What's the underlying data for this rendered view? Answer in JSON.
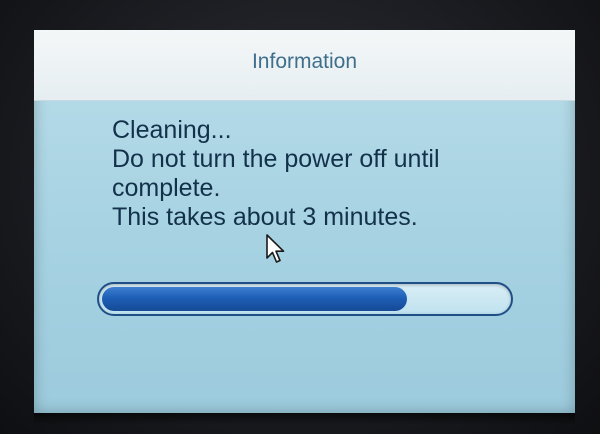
{
  "dialog": {
    "title": "Information",
    "message_lines": [
      "Cleaning...",
      "Do not turn the power off until",
      "complete.",
      "This takes about 3 minutes."
    ]
  },
  "progress": {
    "fraction": 0.75
  },
  "cursor": {
    "icon": "arrow-pointer-icon"
  },
  "colors": {
    "screen_bg": "#a6d2e2",
    "titlebar_bg": "#eef4f6",
    "title_text": "#3f6f8c",
    "message_text": "#13314a",
    "progress_fill": "#1e5eb6",
    "progress_border": "#1f4f86"
  }
}
